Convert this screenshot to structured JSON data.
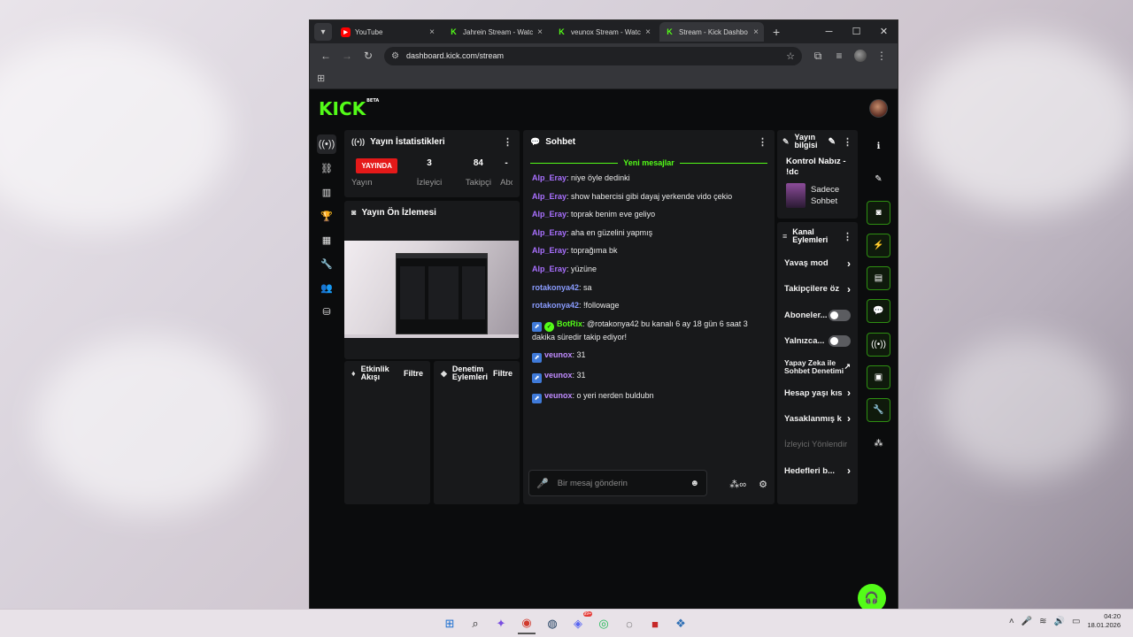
{
  "browser": {
    "tabs": [
      {
        "title": "YouTube",
        "favicon": "youtube-icon",
        "active": false
      },
      {
        "title": "Jahrein Stream - Watc",
        "favicon": "kick-icon",
        "active": false
      },
      {
        "title": "veunox Stream - Watc",
        "favicon": "kick-icon",
        "active": false
      },
      {
        "title": "Stream - Kick Dashbo",
        "favicon": "kick-icon",
        "active": true
      }
    ],
    "url": "dashboard.kick.com/stream"
  },
  "kick": {
    "logo": "KICK",
    "logo_beta": "BETA",
    "stats": {
      "title": "Yayın İstatistikleri",
      "live_badge": "YAYINDA",
      "items": [
        {
          "value": "",
          "label": "Yayın"
        },
        {
          "value": "3",
          "label": "İzleyici"
        },
        {
          "value": "84",
          "label": "Takipçi"
        },
        {
          "value": "-",
          "label": "Abo"
        }
      ]
    },
    "preview": {
      "title": "Yayın Ön İzlemesi"
    },
    "activity": {
      "title": "Etkinlik Akışı",
      "filter": "Filtre"
    },
    "mod_actions": {
      "title": "Denetim Eylemleri",
      "filter": "Filtre"
    },
    "chat": {
      "title": "Sohbet",
      "new_messages": "Yeni mesajlar",
      "messages": [
        {
          "user": "Alp_Eray",
          "color": "#a970ff",
          "text": ": niye öyle dedinki",
          "badges": []
        },
        {
          "user": "Alp_Eray",
          "color": "#a970ff",
          "text": ": show habercisi gibi dayaj yerkende vido çekio",
          "badges": []
        },
        {
          "user": "Alp_Eray",
          "color": "#a970ff",
          "text": ": toprak benim eve geliyo",
          "badges": []
        },
        {
          "user": "Alp_Eray",
          "color": "#a970ff",
          "text": ": aha en güzelini yapmış",
          "badges": []
        },
        {
          "user": "Alp_Eray",
          "color": "#a970ff",
          "text": ": toprağıma bk",
          "badges": []
        },
        {
          "user": "Alp_Eray",
          "color": "#a970ff",
          "text": ": yüzüne",
          "badges": []
        },
        {
          "user": "rotakonya42",
          "color": "#8a9cff",
          "text": ": sa",
          "badges": []
        },
        {
          "user": "rotakonya42",
          "color": "#8a9cff",
          "text": ": !followage",
          "badges": []
        },
        {
          "user": "BotRix",
          "color": "#53fc18",
          "text": ": @rotakonya42 bu kanalı 6 ay 18 gün 6 saat 3 dakika süredir takip ediyor!",
          "badges": [
            "bl",
            "gr"
          ]
        },
        {
          "user": "veunox",
          "color": "#c08cff",
          "text": ": 31",
          "badges": [
            "bl"
          ]
        },
        {
          "user": "veunox",
          "color": "#c08cff",
          "text": ": 31",
          "badges": [
            "bl"
          ]
        },
        {
          "user": "veunox",
          "color": "#c08cff",
          "text": ": o yeri nerden buldubn",
          "badges": [
            "bl"
          ]
        }
      ],
      "input_placeholder": "Bir mesaj gönderin"
    },
    "stream_info": {
      "title_line1": "Yayın",
      "title_line2": "bilgisi",
      "stream_title": "Kontrol Nabız - !dc",
      "category_line1": "Sadece",
      "category_line2": "Sohbet"
    },
    "channel_actions": {
      "title_line1": "Kanal",
      "title_line2": "Eylemleri",
      "items": [
        {
          "label": "Yavaş mod",
          "control": "chevron"
        },
        {
          "label": "Takipçilere öz",
          "control": "chevron"
        },
        {
          "label": "Aboneler...",
          "control": "toggle"
        },
        {
          "label": "Yalnızca...",
          "control": "toggle"
        },
        {
          "label": "Yapay Zeka ile Sohbet Denetimi",
          "control": "external"
        },
        {
          "label": "Hesap yaşı kıs",
          "control": "chevron"
        },
        {
          "label": "Yasaklanmış k",
          "control": "chevron"
        },
        {
          "label": "İzleyici Yönlendir",
          "control": "disabled"
        },
        {
          "label": "Hedefleri b...",
          "control": "chevron"
        }
      ]
    }
  },
  "taskbar": {
    "time": "04:20",
    "date": "18.01.2026",
    "discord_badge": "99+"
  }
}
